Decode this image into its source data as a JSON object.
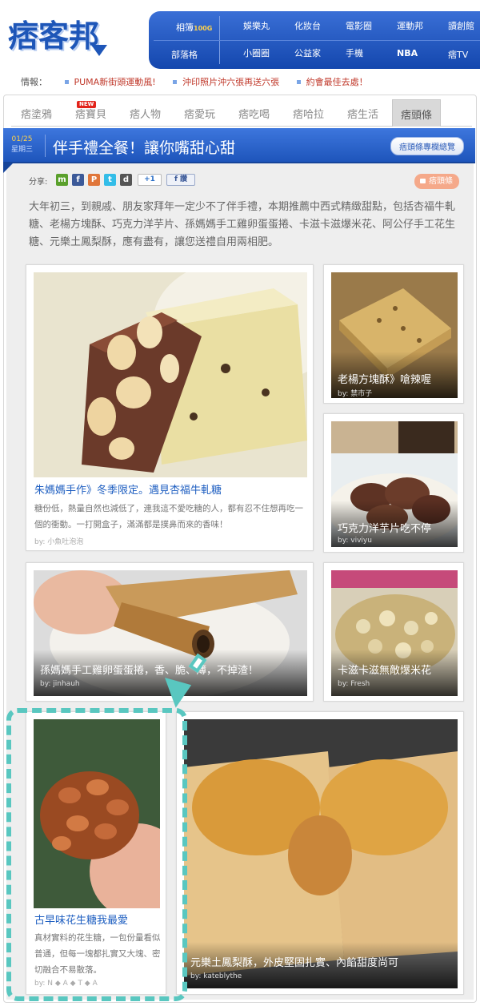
{
  "header": {
    "logo": "痞客邦",
    "nav": [
      {
        "label": "相簿",
        "badge": "100G"
      },
      {
        "label": "娛樂丸"
      },
      {
        "label": "化妝台"
      },
      {
        "label": "電影圈"
      },
      {
        "label": "運動邦"
      },
      {
        "label": "讀創館"
      },
      {
        "label": "部落格"
      },
      {
        "label": "小圈圈"
      },
      {
        "label": "公益家"
      },
      {
        "label": "手機"
      },
      {
        "label": "NBA"
      },
      {
        "label": "痞TV"
      }
    ],
    "news_label": "情報：",
    "news": [
      "PUMA新街頭運動風!",
      "沖印照片沖六張再送六張",
      "約會最佳去處！"
    ]
  },
  "tabs": [
    "痞塗鴉",
    "痞寶貝",
    "痞人物",
    "痞愛玩",
    "痞吃喝",
    "痞哈拉",
    "痞生活",
    "痞頭條"
  ],
  "new_badge": "NEW",
  "titlebar": {
    "date": "01/25",
    "weekday": "星期三",
    "title": "伴手禮全餐！讓你嘴甜心甜",
    "all_button": "痞頭條專欄總覽"
  },
  "share": {
    "label": "分享:",
    "icons": [
      "m",
      "f",
      "P",
      "t",
      "d",
      "+1",
      "f 讚"
    ],
    "tag": "痞頭條"
  },
  "intro": "大年初三，到親戚、朋友家拜年一定少不了伴手禮，本期推薦中西式精緻甜點，包括杏福牛軋糖、老楊方塊酥、巧克力洋芋片、孫媽媽手工雞卵蛋蛋捲、卡滋卡滋爆米花、阿公仔手工花生糖、元樂土鳳梨酥，應有盡有，讓您送禮自用兩相肥。",
  "cards": {
    "nougat": {
      "title": "朱媽媽手作》冬季限定。遇見杏福牛軋糖",
      "desc": "糖份低，熱量自然也減低了，連我這不愛吃糖的人，都有忍不住想再吃一個的衝動。一打開盒子，滿滿都是撲鼻而來的香味！",
      "by": "by: 小魚吐泡泡"
    },
    "cracker": {
      "title": "老楊方塊酥》嗆辣喔",
      "by": "by: 禁市子"
    },
    "chips": {
      "title": "巧克力洋芋片吃不停",
      "by": "by: viviyu"
    },
    "eggroll": {
      "title": "孫媽媽手工雞卵蛋蛋捲，香、脆、薄，不掉渣！",
      "by": "by: jinhauh"
    },
    "popcorn": {
      "title": "卡滋卡滋無敵爆米花",
      "by": "by: Fresh"
    },
    "peanut": {
      "title": "古早味花生糖我最愛",
      "desc": "真材實料的花生糖，一包份量看似普通，但每一塊都扎實又大塊、密切融合不易散落。",
      "by": "by: N ◆ A ◆ T ◆ A"
    },
    "pineapple": {
      "title": "元樂土鳳梨酥，外皮堅固扎實、內餡甜度尚可",
      "by": "by: kateblythe"
    }
  },
  "colors": {
    "brand_blue": "#1e56b8",
    "link_blue": "#1f5fc1",
    "decoration_teal": "#59c7c0",
    "news_red": "#c0392b"
  }
}
